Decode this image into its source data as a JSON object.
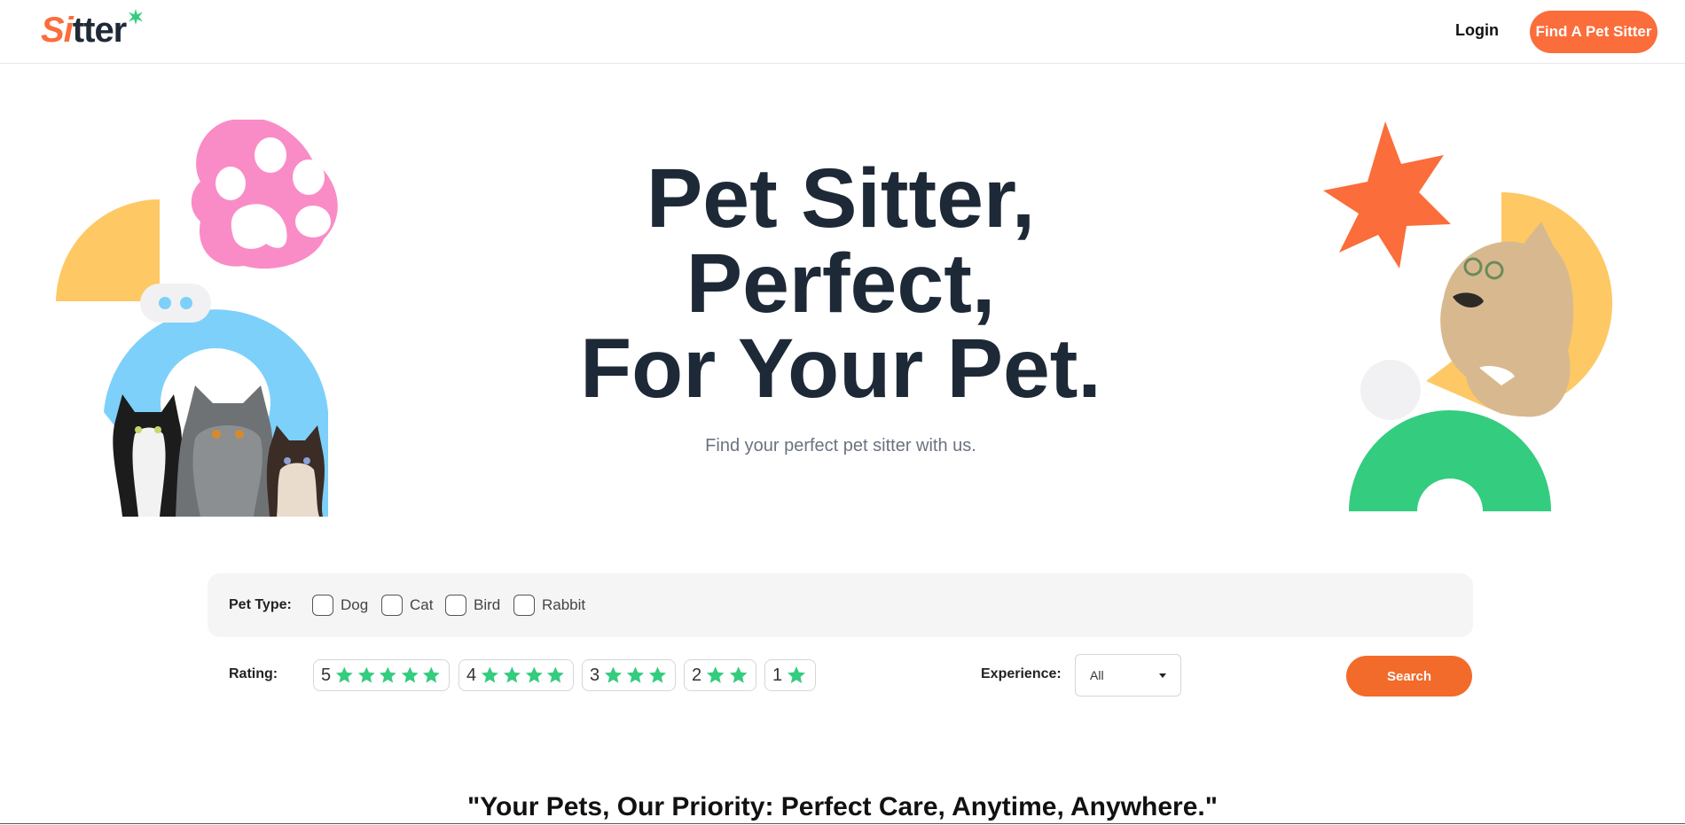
{
  "brand": {
    "logo_first": "Si",
    "logo_rest": "tter",
    "accent": "#fb6d3a",
    "green": "#34cc7f"
  },
  "header": {
    "login_label": "Login",
    "cta_label": "Find A Pet Sitter"
  },
  "hero": {
    "title_lines": [
      "Pet Sitter,",
      "Perfect,",
      "For Your Pet."
    ],
    "subtitle": "Find your perfect pet sitter with us."
  },
  "filters": {
    "pet_type_label": "Pet Type:",
    "pet_types": [
      "Dog",
      "Cat",
      "Bird",
      "Rabbit"
    ],
    "rating_label": "Rating:",
    "ratings": [
      {
        "label": "5",
        "stars": 5
      },
      {
        "label": "4",
        "stars": 4
      },
      {
        "label": "3",
        "stars": 3
      },
      {
        "label": "2",
        "stars": 2
      },
      {
        "label": "1",
        "stars": 1
      }
    ],
    "experience_label": "Experience:",
    "experience_value": "All",
    "search_label": "Search"
  },
  "tagline": "\"Your Pets, Our Priority: Perfect Care, Anytime, Anywhere.\""
}
